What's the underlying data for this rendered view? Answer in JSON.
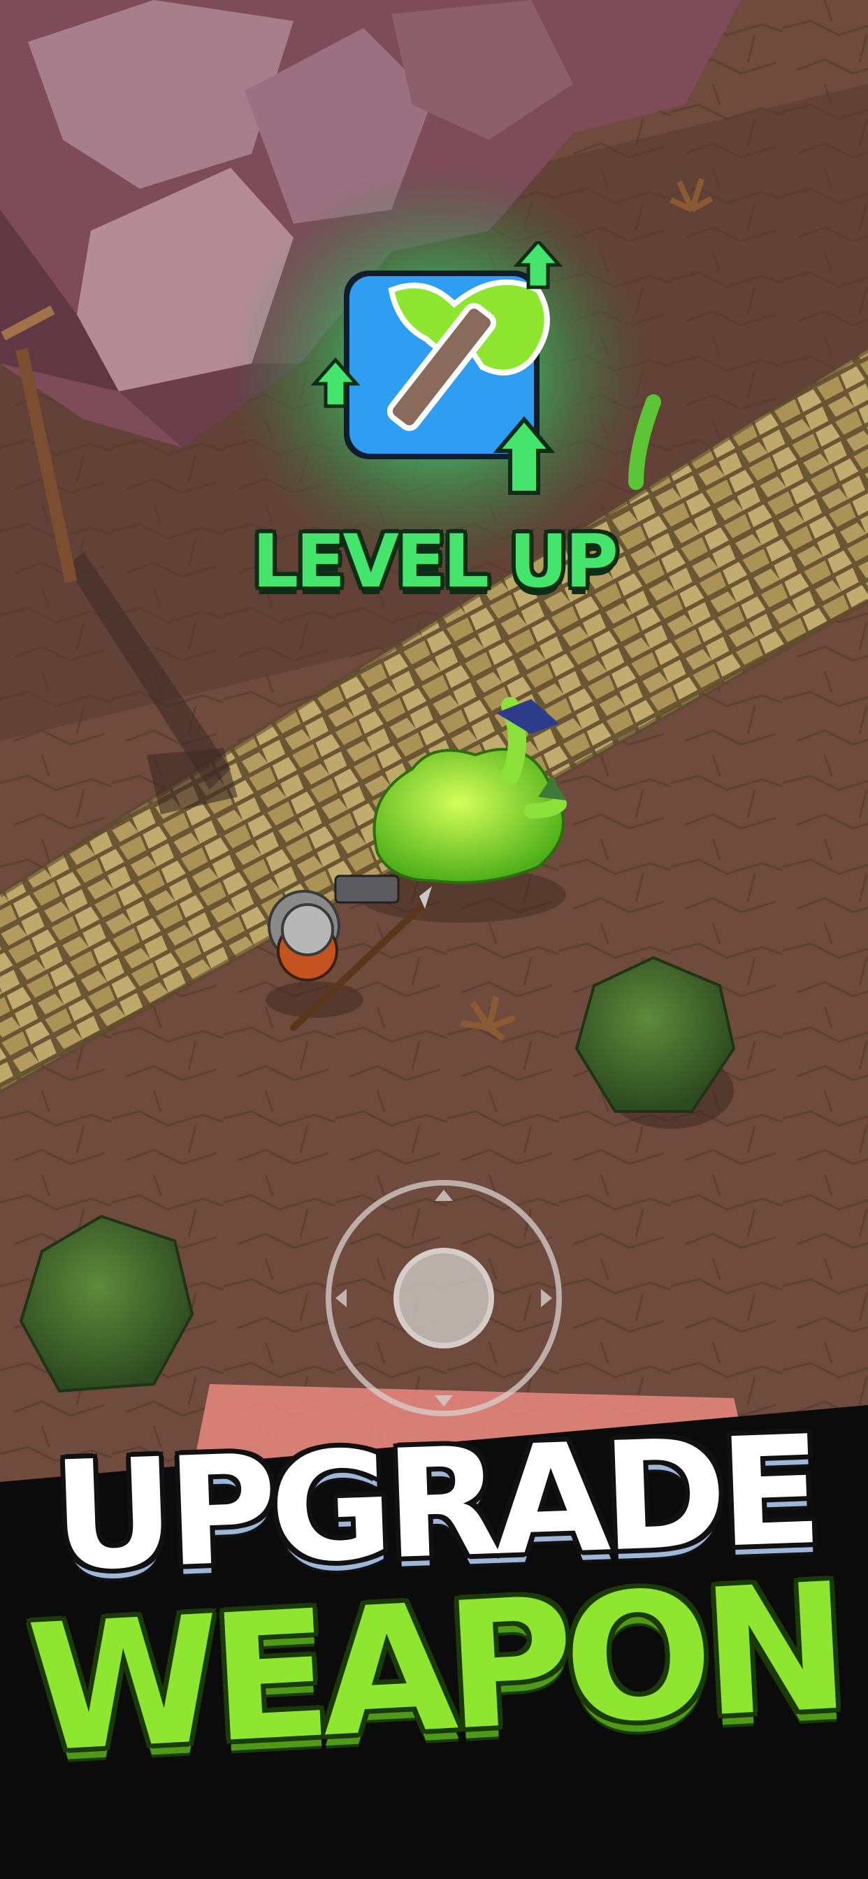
{
  "game": {
    "level_up_text": "LEVEL UP",
    "weapon_icon": "green-axe-icon",
    "upgrade_arrow_icon": "up-arrow-icon"
  },
  "banner": {
    "line1": "UPGRADE",
    "line2": "WEAPON"
  },
  "controls": {
    "joystick_icon": "virtual-joystick"
  },
  "colors": {
    "level_up_green": "#45e46d",
    "weapon_green": "#8fe630",
    "icon_blue": "#2f9ef2",
    "banner_black": "#0b0b0b",
    "danger_zone": "#e2847b"
  }
}
